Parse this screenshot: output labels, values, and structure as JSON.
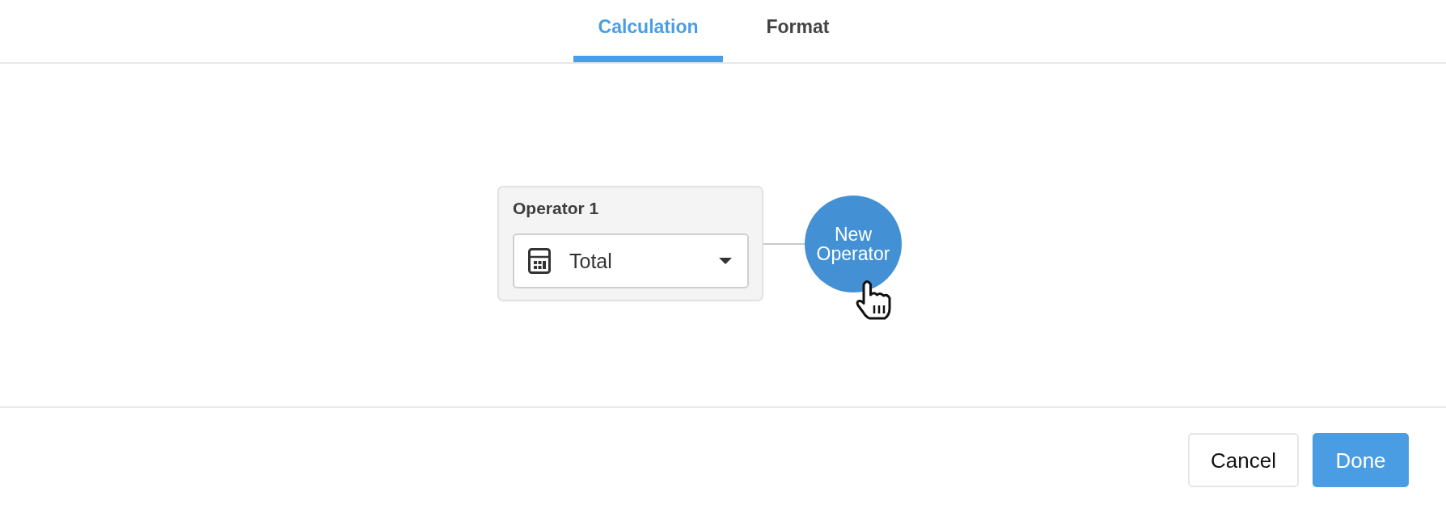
{
  "tabs": [
    {
      "label": "Calculation",
      "selected": true
    },
    {
      "label": "Format",
      "selected": false
    }
  ],
  "operators": [
    {
      "title": "Operator 1",
      "value": "Total"
    }
  ],
  "new_operator": {
    "label": "New Operator"
  },
  "buttons": [
    {
      "label": "Cancel",
      "kind": "secondary"
    },
    {
      "label": "Done",
      "kind": "primary"
    }
  ]
}
